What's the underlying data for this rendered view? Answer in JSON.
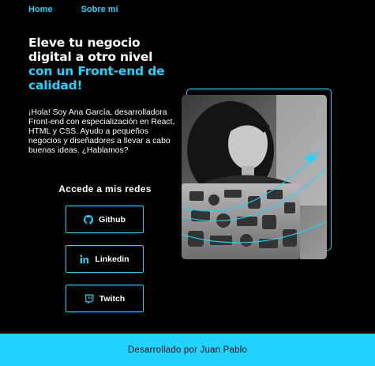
{
  "nav": {
    "home": "Home",
    "about": "Sobre mí"
  },
  "hero": {
    "title_line1": "Eleve tu negocio",
    "title_line2": "digital a otro nivel",
    "title_highlight": "con un Front-end de calidad!",
    "intro": "¡Hola! Soy Ana García, desarrolladora Front-end con especialización en React, HTML y CSS. Ayudo a pequeños negocios y diseñadores a llevar a cabo buenas ideas. ¿Hablamos?"
  },
  "socials": {
    "title": "Accede a mis redes",
    "github": "Github",
    "linkedin": "Linkedin",
    "twitch": "Twitch"
  },
  "icons": [
    "github-icon",
    "linkedin-icon",
    "twitch-icon",
    "sparkle-icon"
  ],
  "colors": {
    "accent": "#22d4fd",
    "background": "#000000",
    "footer_text": "#111111"
  },
  "footer": {
    "text": "Desarrollado por Juan Pablo"
  }
}
